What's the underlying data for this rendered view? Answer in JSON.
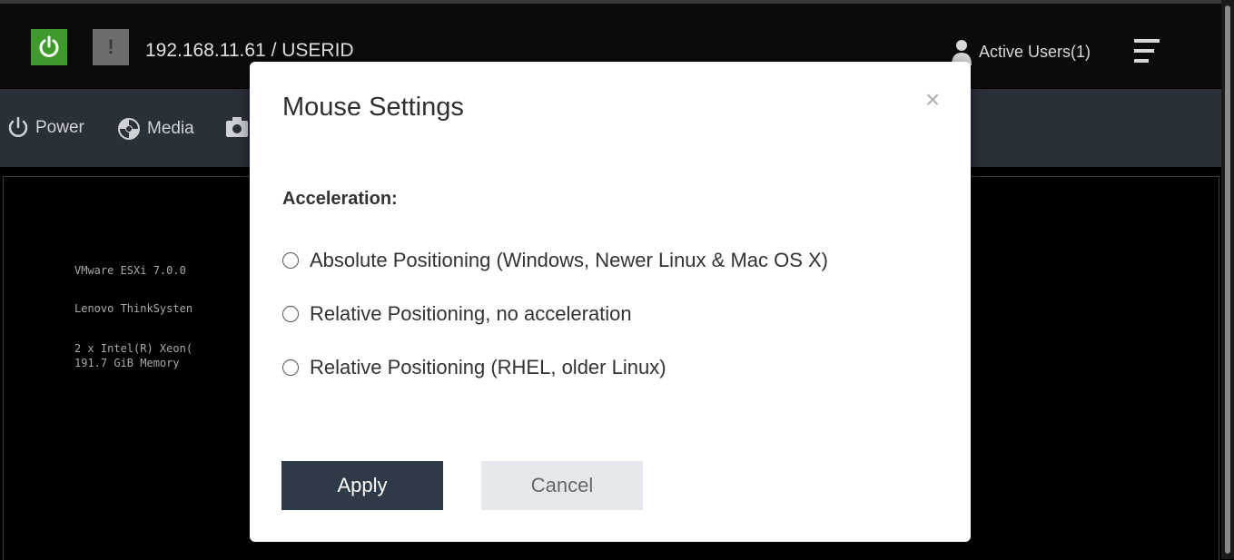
{
  "header": {
    "host_title": "192.168.11.61 / USERID",
    "warning_glyph": "!",
    "active_users": "Active Users(1)"
  },
  "toolbar": {
    "items": [
      {
        "label": "Power",
        "icon": "power-icon"
      },
      {
        "label": "Media",
        "icon": "media-icon"
      },
      {
        "label": "",
        "icon": "camera-icon"
      }
    ]
  },
  "console": {
    "lines": [
      "VMware ESXi 7.0.0",
      "Lenovo ThinkSysten",
      "2 x Intel(R) Xeon(",
      "191.7 GiB Memory"
    ]
  },
  "modal": {
    "title": "Mouse Settings",
    "close_glyph": "×",
    "section_label": "Acceleration:",
    "options": [
      {
        "label": "Absolute Positioning (Windows, Newer Linux & Mac OS X)",
        "selected": false
      },
      {
        "label": "Relative Positioning, no acceleration",
        "selected": false
      },
      {
        "label": "Relative Positioning (RHEL, older Linux)",
        "selected": false
      }
    ],
    "apply_label": "Apply",
    "cancel_label": "Cancel"
  },
  "colors": {
    "power_green": "#3f9a2e",
    "toolbar_bg": "#2a3038",
    "apply_bg": "#2e3a47",
    "cancel_bg": "#e4e7ec"
  }
}
